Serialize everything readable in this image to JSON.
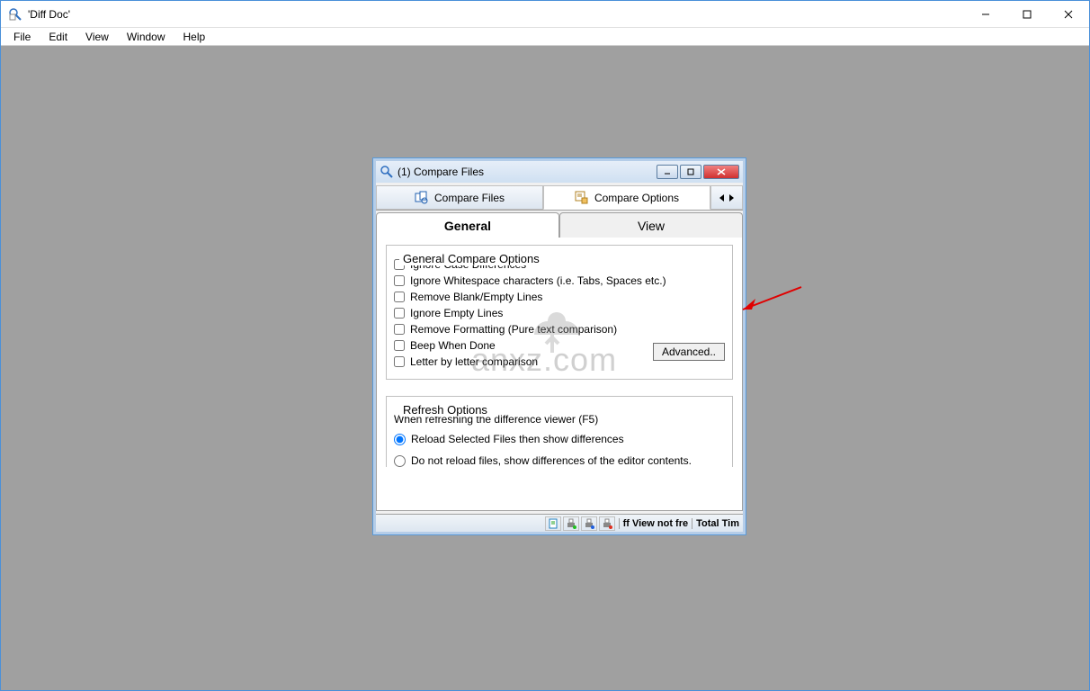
{
  "window": {
    "title": "'Diff Doc'"
  },
  "menubar": {
    "items": [
      "File",
      "Edit",
      "View",
      "Window",
      "Help"
    ]
  },
  "child_window": {
    "title": "(1) Compare Files"
  },
  "toolbar": {
    "tabs": [
      "Compare Files",
      "Compare Options"
    ]
  },
  "sub_tabs": {
    "general": "General",
    "view": "View"
  },
  "general_group": {
    "title": "General Compare Options",
    "opts": [
      "Ignore Case Differences",
      "Ignore Whitespace characters (i.e. Tabs, Spaces etc.)",
      "Remove Blank/Empty Lines",
      "Ignore Empty Lines",
      "Remove Formatting (Pure text comparison)",
      "Beep When Done",
      "Letter by letter comparison"
    ],
    "advanced": "Advanced.."
  },
  "refresh_group": {
    "title": "Refresh Options",
    "subtitle": "When refreshing the difference viewer (F5)",
    "radio1": "Reload Selected Files then show differences",
    "radio2": "Do not reload files, show differences of the editor contents."
  },
  "statusbar": {
    "text1": "ff View not fre",
    "text2": "Total Tim"
  },
  "watermark": {
    "text": "anxz.com"
  }
}
